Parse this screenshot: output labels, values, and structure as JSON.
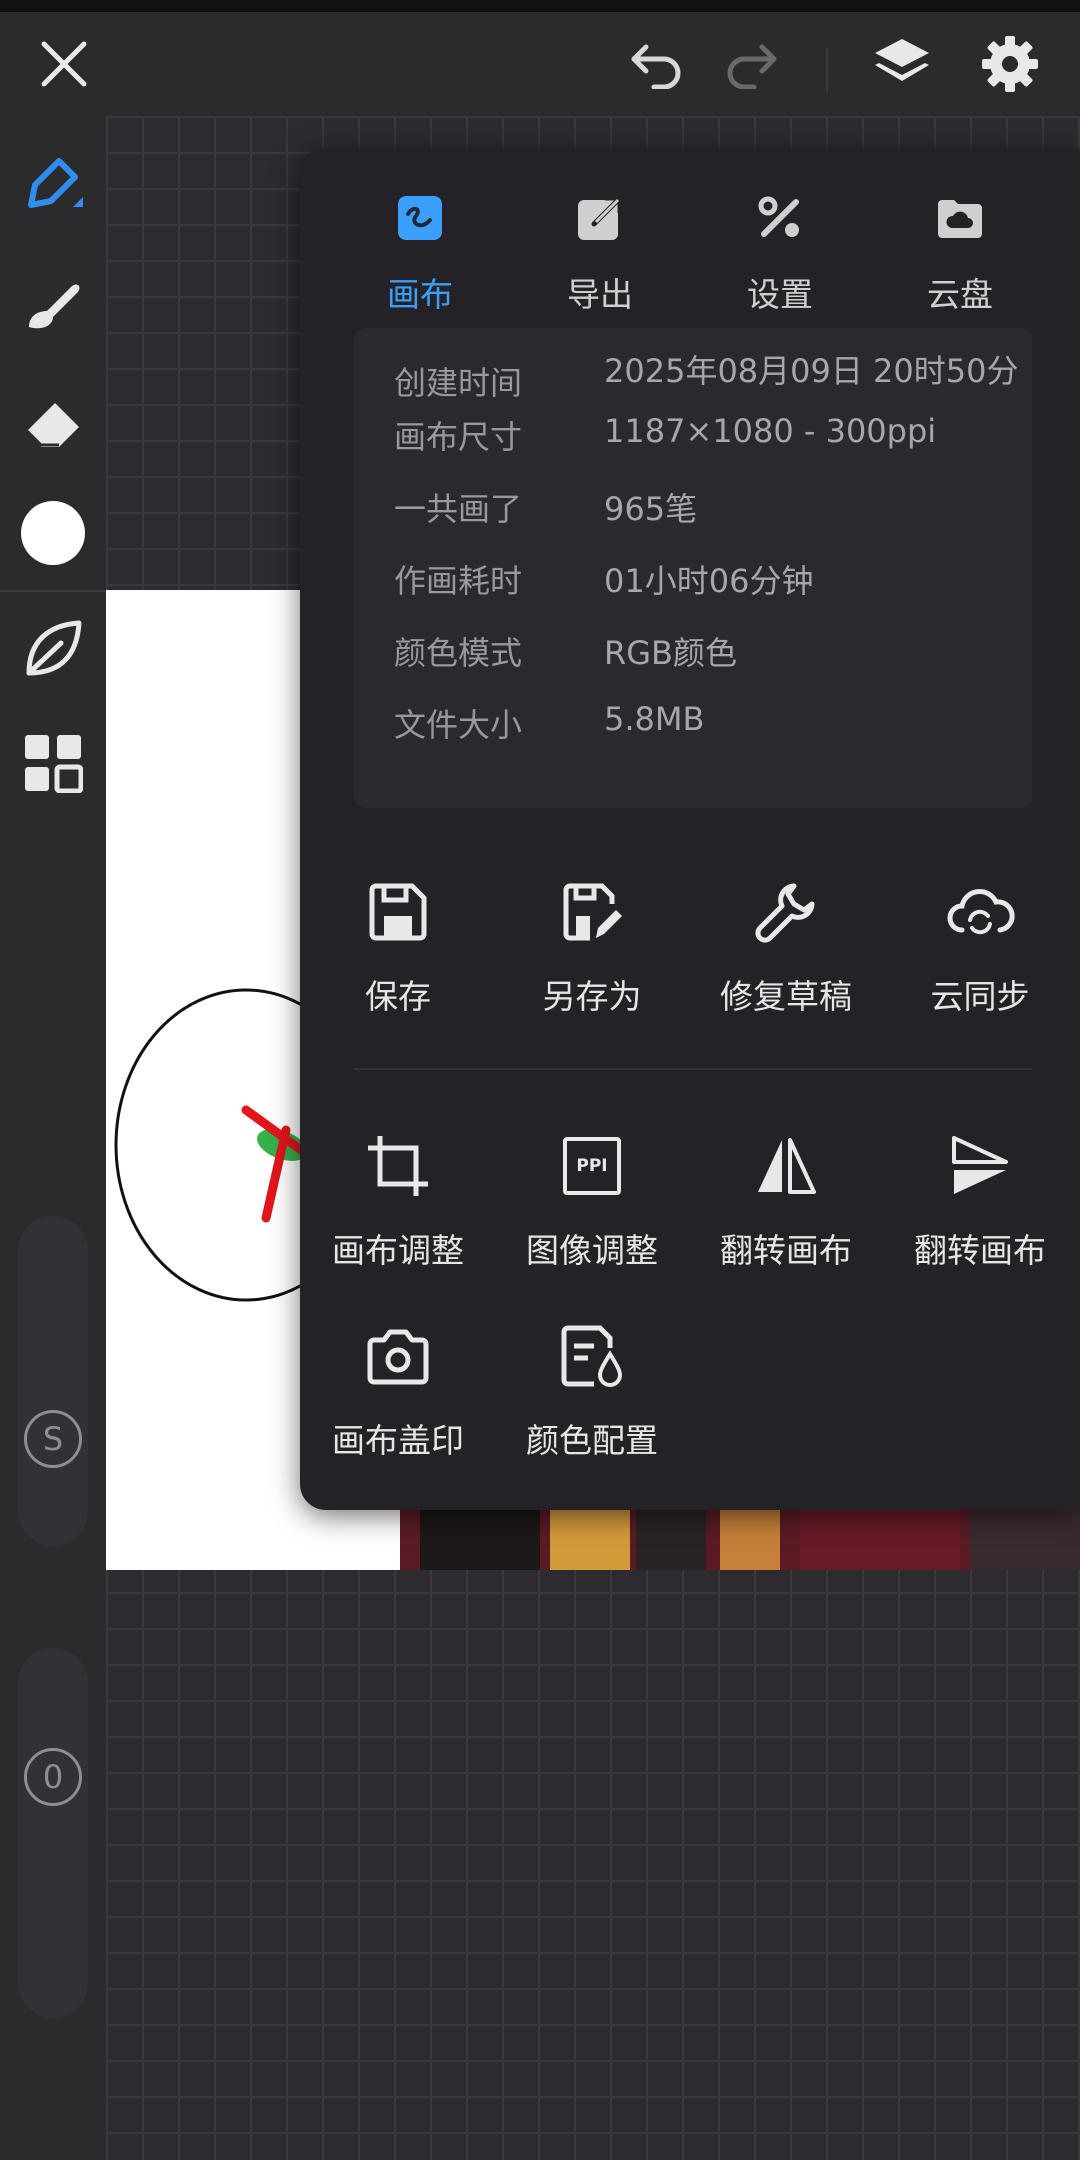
{
  "colors": {
    "accent": "#3aa0ff",
    "panel_bg": "#242226",
    "info_bg": "#2b292d"
  },
  "topbar": {
    "close_icon": "close-icon",
    "undo_icon": "undo-icon",
    "redo_icon": "redo-icon",
    "layers_icon": "layers-icon",
    "settings_icon": "gear-icon"
  },
  "sidebar": {
    "tools": [
      "pen-icon",
      "brush-icon",
      "eraser-icon",
      "color-swatch",
      "leaf-icon",
      "grid-icon"
    ],
    "size_badge": "S",
    "opacity_badge": "0"
  },
  "panel": {
    "tabs": [
      {
        "label": "画布",
        "icon": "canvas-icon",
        "active": true
      },
      {
        "label": "导出",
        "icon": "export-icon",
        "active": false
      },
      {
        "label": "设置",
        "icon": "tools-icon",
        "active": false
      },
      {
        "label": "云盘",
        "icon": "cloud-disk-icon",
        "active": false
      }
    ],
    "info": [
      {
        "key": "创建时间",
        "value": "2025年08月09日 20时50分"
      },
      {
        "key": "画布尺寸",
        "value": "1187×1080 - 300ppi"
      },
      {
        "key": "一共画了",
        "value": "965笔"
      },
      {
        "key": "作画耗时",
        "value": "01小时06分钟"
      },
      {
        "key": "颜色模式",
        "value": "RGB颜色"
      },
      {
        "key": "文件大小",
        "value": "5.8MB"
      }
    ],
    "file_actions": [
      {
        "label": "保存",
        "icon": "save-icon"
      },
      {
        "label": "另存为",
        "icon": "save-as-icon"
      },
      {
        "label": "修复草稿",
        "icon": "wrench-icon"
      },
      {
        "label": "云同步",
        "icon": "cloud-sync-icon"
      }
    ],
    "canvas_actions": [
      {
        "label": "画布调整",
        "icon": "crop-icon"
      },
      {
        "label": "图像调整",
        "icon": "ppi-icon",
        "icon_text": "PPI"
      },
      {
        "label": "翻转画布",
        "icon": "flip-horizontal-icon"
      },
      {
        "label": "翻转画布",
        "icon": "flip-vertical-icon"
      },
      {
        "label": "画布盖印",
        "icon": "camera-icon"
      },
      {
        "label": "颜色配置",
        "icon": "color-config-icon"
      }
    ]
  }
}
